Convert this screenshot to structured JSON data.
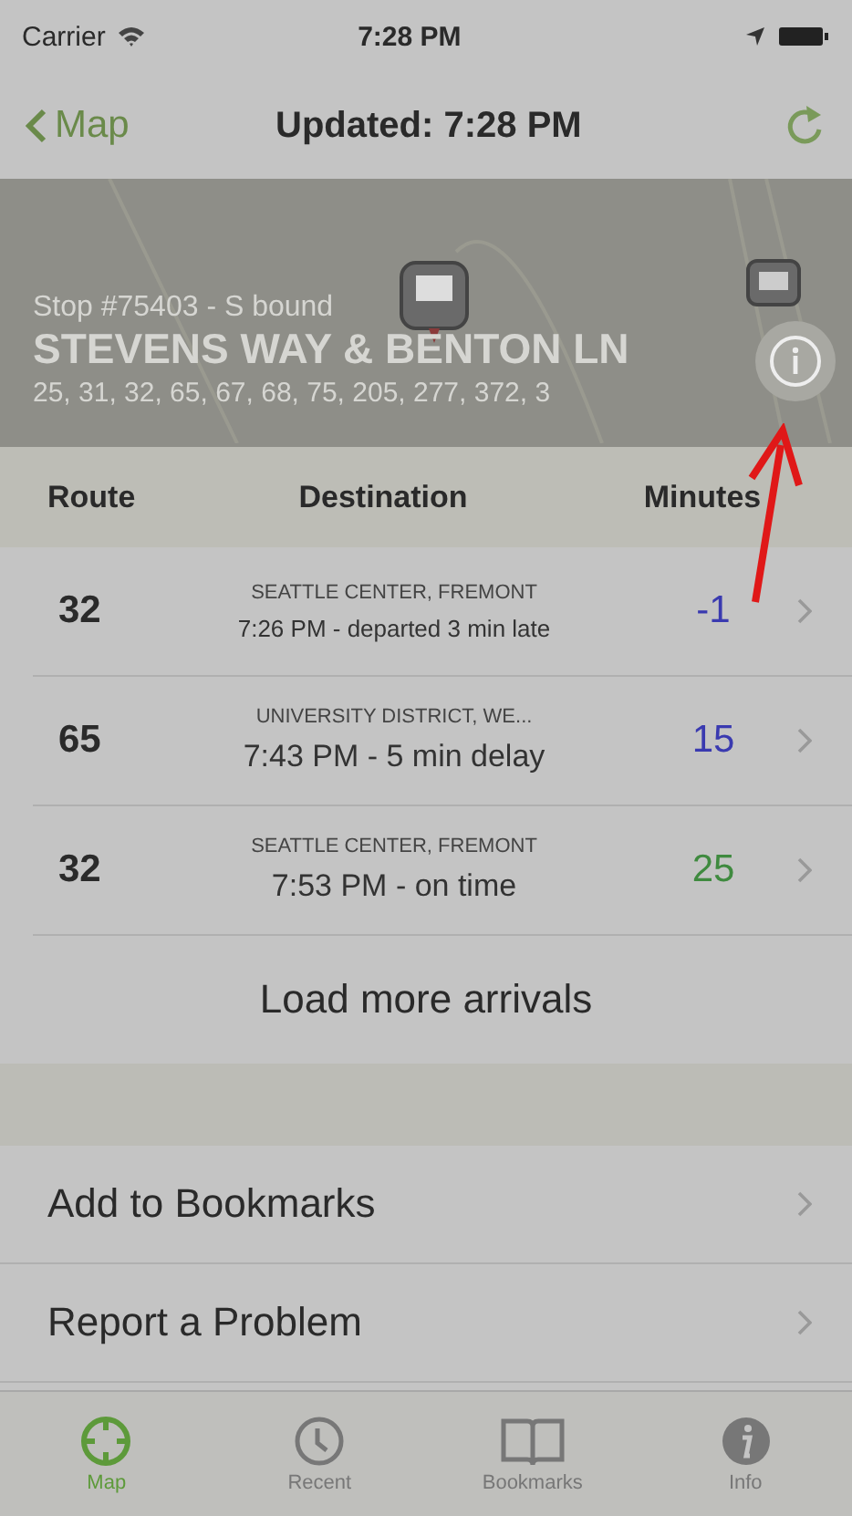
{
  "status_bar": {
    "carrier": "Carrier",
    "time": "7:28 PM"
  },
  "nav": {
    "back": "Map",
    "title": "Updated: 7:28 PM"
  },
  "stop": {
    "number": "Stop #75403 - S bound",
    "name": "STEVENS WAY & BENTON LN",
    "routes": "25, 31, 32, 65, 67, 68, 75, 205, 277, 372, 3"
  },
  "table": {
    "columns": [
      "Route",
      "Destination",
      "Minutes"
    ],
    "rows": [
      {
        "route": "32",
        "destination": "SEATTLE CENTER, FREMONT",
        "status": "7:26 PM - departed 3 min late",
        "minutes": "-1",
        "color": "#3a3ab0"
      },
      {
        "route": "65",
        "destination": "UNIVERSITY DISTRICT, WE...",
        "status": "7:43 PM - 5 min delay",
        "minutes": "15",
        "color": "#3a3ab0"
      },
      {
        "route": "32",
        "destination": "SEATTLE CENTER, FREMONT",
        "status": "7:53 PM - on time",
        "minutes": "25",
        "color": "#3f8a3f"
      }
    ]
  },
  "load_more": "Load more arrivals",
  "actions": [
    "Add to Bookmarks",
    "Report a Problem"
  ],
  "tabs": [
    {
      "label": "Map",
      "kind": "map",
      "selected": true
    },
    {
      "label": "Recent",
      "kind": "recent",
      "selected": false
    },
    {
      "label": "Bookmarks",
      "kind": "bookmarks",
      "selected": false
    },
    {
      "label": "Info",
      "kind": "info",
      "selected": false
    }
  ]
}
